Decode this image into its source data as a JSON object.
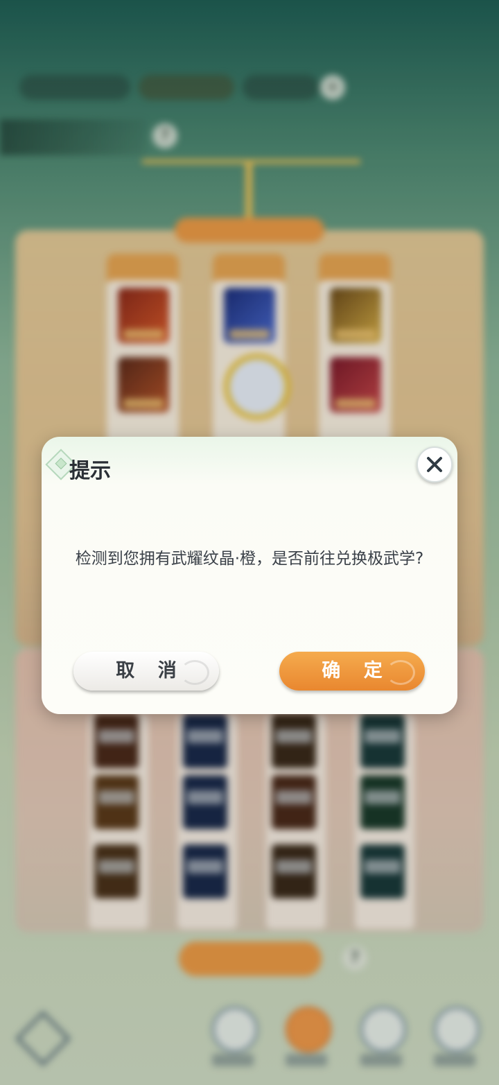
{
  "dialog": {
    "title": "提示",
    "message": "检测到您拥有武耀纹晶·橙，是否前往兑换极武学?",
    "cancel_label": "取 消",
    "confirm_label": "确 定",
    "close_icon": "close-icon"
  },
  "colors": {
    "confirm_orange": "#e9872f",
    "dialog_bg": "#fdfdf8",
    "text_dark": "#2a2f35"
  }
}
